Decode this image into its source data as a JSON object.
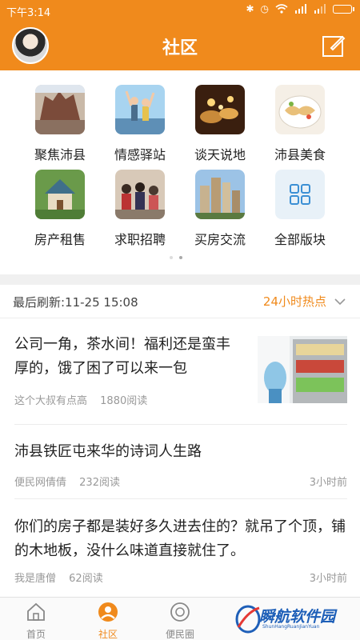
{
  "status": {
    "time": "下午3:14"
  },
  "header": {
    "title": "社区"
  },
  "boards": [
    {
      "label": "聚焦沛县",
      "icon": "statue-photo"
    },
    {
      "label": "情感驿站",
      "icon": "couple-photo"
    },
    {
      "label": "谈天说地",
      "icon": "candles-photo"
    },
    {
      "label": "沛县美食",
      "icon": "dumplings-photo"
    },
    {
      "label": "房产租售",
      "icon": "house-photo"
    },
    {
      "label": "求职招聘",
      "icon": "crowd-photo"
    },
    {
      "label": "买房交流",
      "icon": "buildings-photo"
    },
    {
      "label": "全部版块",
      "icon": "grid-icon"
    }
  ],
  "feed": {
    "refresh": "最后刷新:11-25 15:08",
    "hot_label": "24小时热点"
  },
  "posts": [
    {
      "title": "公司一角，茶水间！福利还是蛮丰厚的，饿了困了可以来一包",
      "author": "这个大叔有点高",
      "reads": "1880阅读",
      "time": ""
    },
    {
      "title": "沛县铁匠屯来华的诗词人生路",
      "author": "便民网倩倩",
      "reads": "232阅读",
      "time": "3小时前"
    },
    {
      "title": "你们的房子都是装好多久进去住的？就吊了个顶，铺的木地板，没什么味道直接就住了。",
      "author": "我是唐僧",
      "reads": "62阅读",
      "time": "3小时前"
    }
  ],
  "tabs": [
    {
      "label": "首页"
    },
    {
      "label": "社区"
    },
    {
      "label": "便民圈"
    }
  ],
  "watermark": {
    "text": "瞬航软件园",
    "sub": "ShunHangRuanJianYuan"
  },
  "colors": {
    "accent": "#f08a1c",
    "watermark": "#1e5fb8"
  }
}
